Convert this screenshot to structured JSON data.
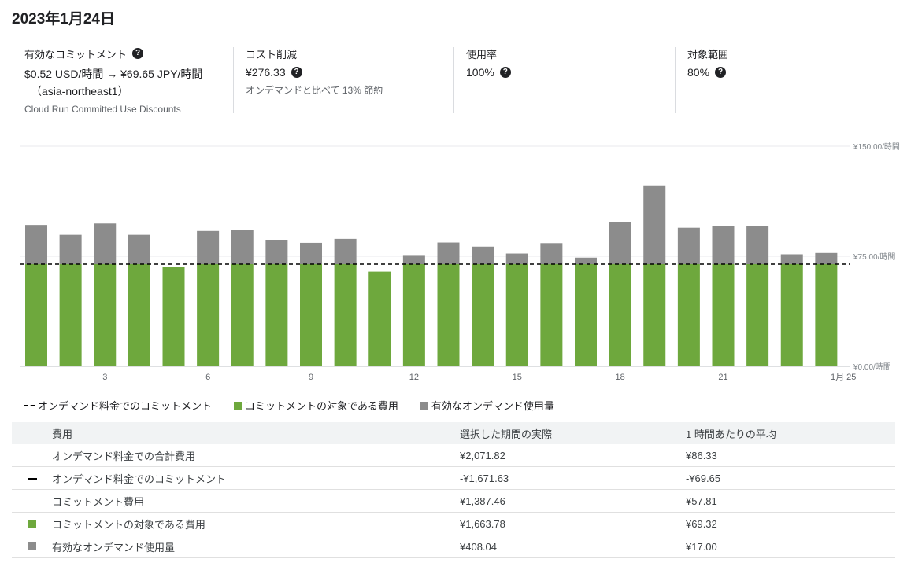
{
  "date_title": "2023年1月24日",
  "cards": {
    "commitment": {
      "label": "有効なコミットメント",
      "value_line1": "$0.52 USD/時間 → ¥69.65 JPY/時間",
      "value_line2": "（asia-northeast1）",
      "sub": "Cloud Run Committed Use Discounts"
    },
    "savings": {
      "label": "コスト削減",
      "value": "¥276.33",
      "sub": "オンデマンドと比べて 13% 節約"
    },
    "utilization": {
      "label": "使用率",
      "value": "100%"
    },
    "coverage": {
      "label": "対象範囲",
      "value": "80%"
    }
  },
  "help_glyph": "?",
  "colors": {
    "covered": "#6ea83d",
    "on_demand": "#8c8c8c",
    "commitment_line": "#000000",
    "grid": "#e8eaed"
  },
  "chart_data": {
    "type": "bar",
    "stacked": true,
    "x": [
      1,
      2,
      3,
      4,
      5,
      6,
      7,
      8,
      9,
      10,
      11,
      12,
      13,
      14,
      15,
      16,
      17,
      18,
      19,
      20,
      21,
      22,
      23,
      24
    ],
    "x_tick_labels": [
      {
        "x": 3,
        "label": "3"
      },
      {
        "x": 6,
        "label": "6"
      },
      {
        "x": 9,
        "label": "9"
      },
      {
        "x": 12,
        "label": "12"
      },
      {
        "x": 15,
        "label": "15"
      },
      {
        "x": 18,
        "label": "18"
      },
      {
        "x": 21,
        "label": "21"
      },
      {
        "x": 24.5,
        "label": "1月 25"
      }
    ],
    "y_ticks": [
      {
        "value": 0,
        "label": "¥0.00/時間"
      },
      {
        "value": 75,
        "label": "¥75.00/時間"
      },
      {
        "value": 150,
        "label": "¥150.00/時間"
      }
    ],
    "ylim": [
      0,
      150
    ],
    "grid": true,
    "series": [
      {
        "name": "コミットメントの対象である費用",
        "color": "#6ea83d",
        "values": [
          69.65,
          69.65,
          69.65,
          69.65,
          67.5,
          69.65,
          69.65,
          69.65,
          69.65,
          69.65,
          64.5,
          69.65,
          69.65,
          69.65,
          69.65,
          69.65,
          69.65,
          69.65,
          69.65,
          69.65,
          69.65,
          69.65,
          69.65,
          69.65
        ]
      },
      {
        "name": "有効なオンデマンド使用量",
        "color": "#8c8c8c",
        "values": [
          26.7,
          20.0,
          27.7,
          20.0,
          0,
          22.6,
          23.2,
          16.6,
          14.5,
          17.2,
          0,
          6.2,
          14.7,
          11.9,
          7.2,
          14.3,
          4.4,
          28.6,
          53.7,
          24.8,
          25.9,
          25.9,
          6.7,
          7.6
        ]
      }
    ],
    "reference_line": {
      "name": "オンデマンド料金でのコミットメント",
      "value": 69.65,
      "style": "dashed"
    },
    "legend": [
      {
        "symbol": "dash",
        "label": "オンデマンド料金でのコミットメント"
      },
      {
        "symbol": "green",
        "label": "コミットメントの対象である費用"
      },
      {
        "symbol": "gray",
        "label": "有効なオンデマンド使用量"
      }
    ],
    "legend_position": "bottom-left"
  },
  "table": {
    "headers": [
      "費用",
      "選択した期間の実際",
      "1 時間あたりの平均"
    ],
    "rows": [
      {
        "symbol": "",
        "name": "オンデマンド料金での合計費用",
        "actual": "¥2,071.82",
        "avg": "¥86.33"
      },
      {
        "symbol": "dash",
        "name": "オンデマンド料金でのコミットメント",
        "actual": "-¥1,671.63",
        "avg": "-¥69.65"
      },
      {
        "symbol": "",
        "name": "コミットメント費用",
        "actual": "¥1,387.46",
        "avg": "¥57.81"
      },
      {
        "symbol": "green",
        "name": "コミットメントの対象である費用",
        "actual": "¥1,663.78",
        "avg": "¥69.32"
      },
      {
        "symbol": "gray",
        "name": "有効なオンデマンド使用量",
        "actual": "¥408.04",
        "avg": "¥17.00"
      }
    ]
  }
}
